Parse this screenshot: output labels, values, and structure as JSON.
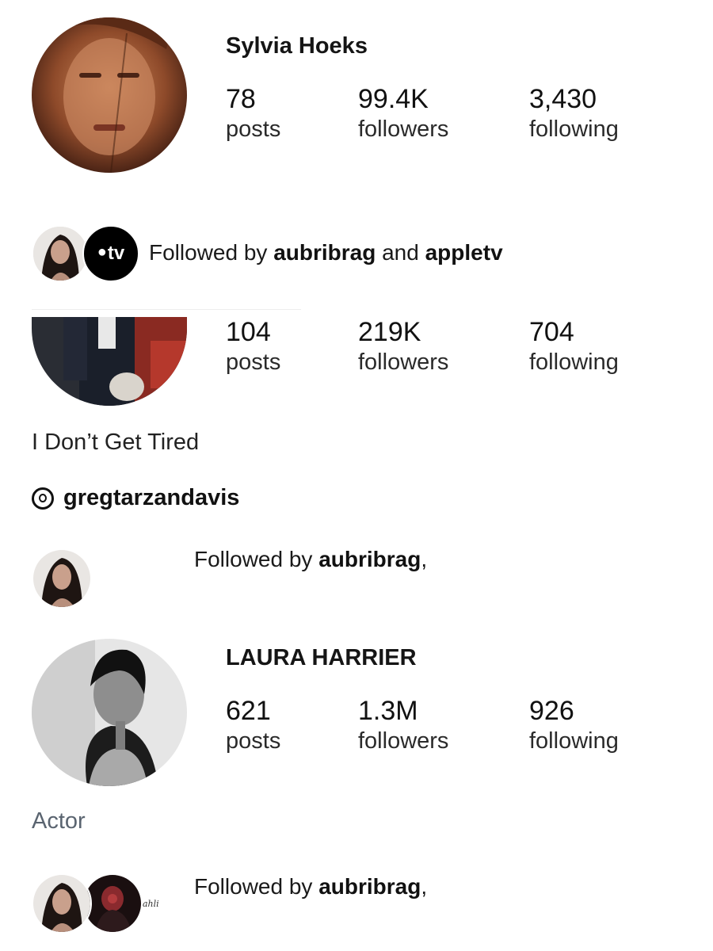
{
  "profiles": [
    {
      "name": "Sylvia Hoeks",
      "posts_value": "78",
      "posts_label": "posts",
      "followers_value": "99.4K",
      "followers_label": "followers",
      "following_value": "3,430",
      "following_label": "following",
      "followed_prefix": "Followed by ",
      "followed_user1": "aubribrag",
      "followed_joiner": " and ",
      "followed_user2": "appletv",
      "tv_badge": "tv"
    },
    {
      "posts_value": "104",
      "posts_label": "posts",
      "followers_value": "219K",
      "followers_label": "followers",
      "following_value": "704",
      "following_label": "following",
      "bio": "I Don’t Get Tired",
      "threads_handle": "gregtarzandavis",
      "followed_prefix": "Followed by ",
      "followed_user1": "aubribrag",
      "followed_suffix": ","
    },
    {
      "name": "LAURA HARRIER",
      "posts_value": "621",
      "posts_label": "posts",
      "followers_value": "1.3M",
      "followers_label": "followers",
      "following_value": "926",
      "following_label": "following",
      "bio": "Actor",
      "followed_prefix": "Followed by ",
      "followed_user1": "aubribrag",
      "followed_suffix": ",",
      "mini_caption": "ahli"
    }
  ],
  "icons": {
    "threads": "threads-icon",
    "apple": "apple-icon"
  },
  "colors": {
    "text": "#111111",
    "muted": "#555555",
    "bio_muted": "#5a6470"
  }
}
